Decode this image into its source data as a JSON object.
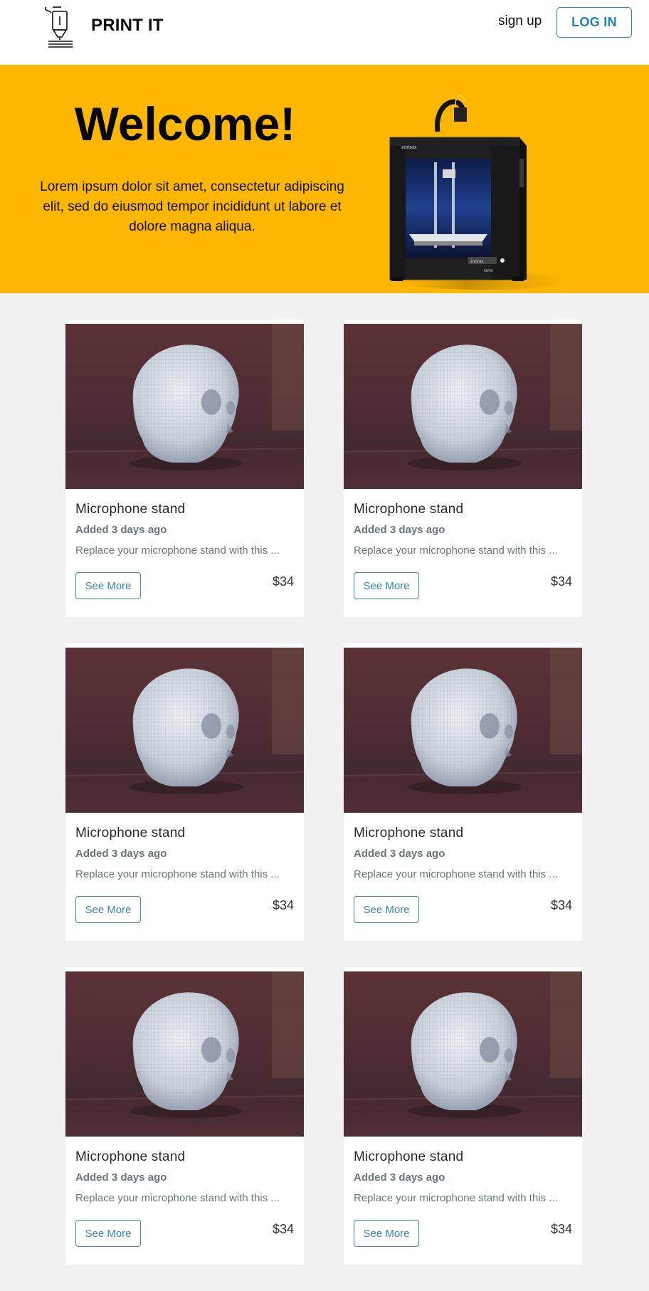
{
  "header": {
    "brand": "PRINT IT",
    "signup_label": "sign up",
    "login_label": "LOG IN"
  },
  "hero": {
    "title": "Welcome!",
    "text": "Lorem ipsum dolor sit amet, consectetur adipiscing elit, sed do eiusmod tempor incididunt ut labore et dolore magna aliqua.",
    "printer_brand": "zortrax",
    "printer_model": "M200"
  },
  "products": [
    {
      "title": "Microphone stand",
      "added": "Added 3 days ago",
      "description": "Replace your microphone stand with this ...",
      "button": "See More",
      "price": "$34"
    },
    {
      "title": "Microphone stand",
      "added": "Added 3 days ago",
      "description": "Replace your microphone stand with this ...",
      "button": "See More",
      "price": "$34"
    },
    {
      "title": "Microphone stand",
      "added": "Added 3 days ago",
      "description": "Replace your microphone stand with this ...",
      "button": "See More",
      "price": "$34"
    },
    {
      "title": "Microphone stand",
      "added": "Added 3 days ago",
      "description": "Replace your microphone stand with this ...",
      "button": "See More",
      "price": "$34"
    },
    {
      "title": "Microphone stand",
      "added": "Added 3 days ago",
      "description": "Replace your microphone stand with this ...",
      "button": "See More",
      "price": "$34"
    },
    {
      "title": "Microphone stand",
      "added": "Added 3 days ago",
      "description": "Replace your microphone stand with this ...",
      "button": "See More",
      "price": "$34"
    }
  ],
  "colors": {
    "hero_bg": "#fdb701",
    "accent": "#2b86c5",
    "page_bg": "#f1f1f1"
  },
  "icons": {
    "logo": "3d-printer-nozzle-icon"
  }
}
